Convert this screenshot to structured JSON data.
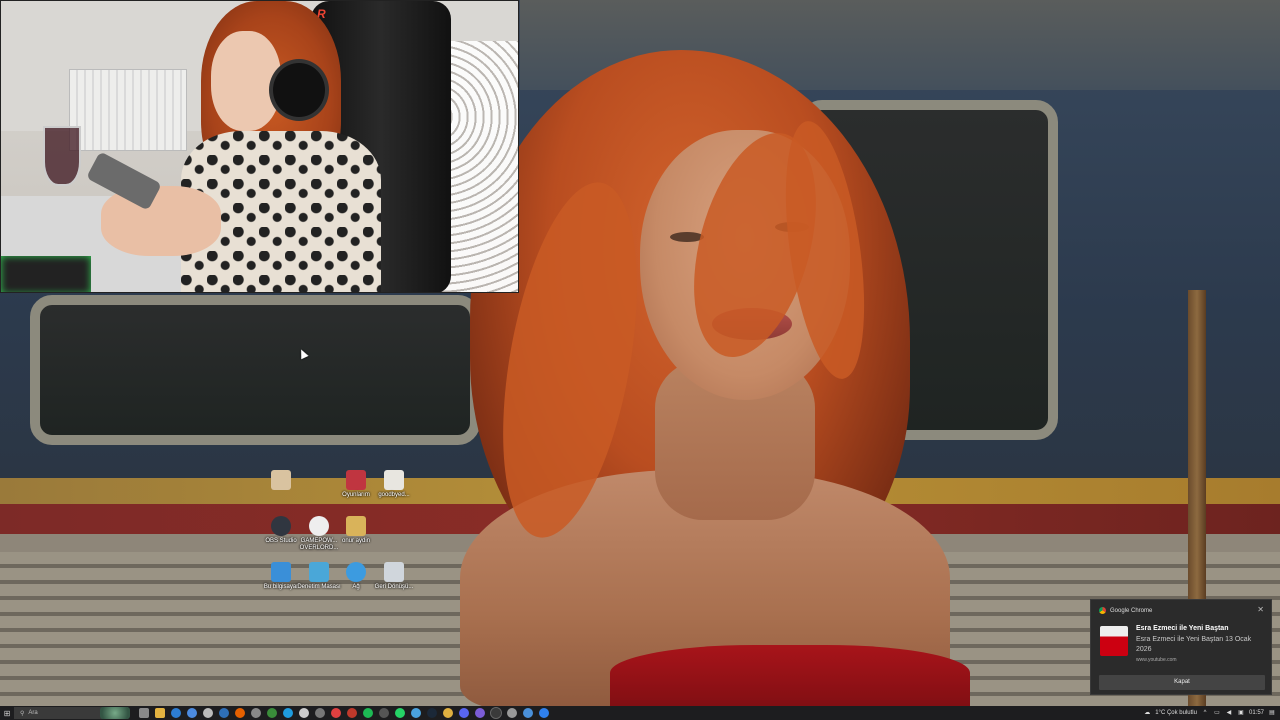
{
  "desktop": {
    "icons": [
      {
        "label": "",
        "color": "#d9c3a0"
      },
      {
        "label": "Oyunlarım",
        "color": "#c03540"
      },
      {
        "label": "goodbyed...",
        "color": "#e8e6e0"
      },
      {
        "label": "OBS Studio",
        "color": "#303640"
      },
      {
        "label": "GAMEPOW... OVERLORD...",
        "color": "#eeeeee"
      },
      {
        "label": "onur aydin",
        "color": "#d9b35a"
      },
      {
        "label": "Bu bilgisayar",
        "color": "#3a8fd8"
      },
      {
        "label": "Denetim Masası",
        "color": "#4aa7d8"
      },
      {
        "label": "Ağ",
        "color": "#3c9be0"
      },
      {
        "label": "Geri Dönüşü...",
        "color": "#d0d6dc"
      }
    ]
  },
  "webcam": {
    "brand_logo": "R"
  },
  "notification": {
    "app_name": "Google Chrome",
    "close_glyph": "✕",
    "title": "Esra Ezmeci ile Yeni Baştan",
    "body": "Esra Ezmeci ile Yeni Baştan 13 Ocak 2026",
    "url": "www.youtube.com",
    "action_label": "Kapat"
  },
  "taskbar": {
    "start_glyph": "⊞",
    "search_placeholder": "Ara",
    "search_glyph": "⚲",
    "apps": [
      {
        "name": "task-view",
        "color": "#8a8a8a"
      },
      {
        "name": "file-explorer",
        "color": "#e3b341"
      },
      {
        "name": "app",
        "color": "#2d7dd2"
      },
      {
        "name": "app",
        "color": "#4c8be0"
      },
      {
        "name": "app",
        "color": "#bbbbbb"
      },
      {
        "name": "app",
        "color": "#2e6fb8"
      },
      {
        "name": "firefox",
        "color": "#e66000"
      },
      {
        "name": "app",
        "color": "#888888"
      },
      {
        "name": "chrome",
        "color": "#3a8d3a"
      },
      {
        "name": "edge",
        "color": "#1f9cde"
      },
      {
        "name": "app",
        "color": "#cccccc"
      },
      {
        "name": "app",
        "color": "#777777"
      },
      {
        "name": "app",
        "color": "#e04040"
      },
      {
        "name": "app",
        "color": "#c0392b"
      },
      {
        "name": "spotify",
        "color": "#1db954"
      },
      {
        "name": "app",
        "color": "#555555"
      },
      {
        "name": "whatsapp",
        "color": "#25d366"
      },
      {
        "name": "app",
        "color": "#4aa3df"
      },
      {
        "name": "steam",
        "color": "#1b2838"
      },
      {
        "name": "folder",
        "color": "#e0b040"
      },
      {
        "name": "app",
        "color": "#5865f2"
      },
      {
        "name": "app",
        "color": "#7b5cd6"
      },
      {
        "name": "obs",
        "color": "#3a3a3a"
      },
      {
        "name": "app",
        "color": "#999999"
      },
      {
        "name": "app",
        "color": "#4a90d9"
      },
      {
        "name": "app",
        "color": "#2f80ed"
      }
    ],
    "tray": {
      "weather": "1°C Çok bulutlu",
      "chevron": "^",
      "time": "01:57"
    }
  }
}
